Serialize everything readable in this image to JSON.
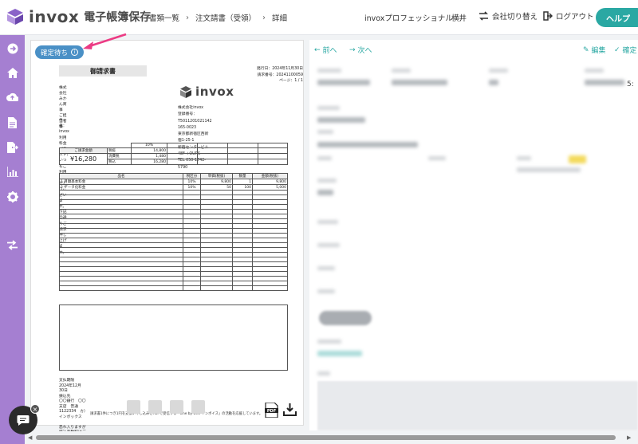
{
  "header": {
    "logo_text": "invox",
    "logo_subtitle": "電子帳簿保存",
    "breadcrumb": [
      "書類一覧",
      "注文請書（受領）",
      "詳細"
    ],
    "company": "invoxプロフェッショナル",
    "user": "横井",
    "switch_company": "会社切り替え",
    "logout": "ログアウト",
    "help": "ヘルプ"
  },
  "sidebar": {
    "items": [
      "arrow-right-circle-icon",
      "home-icon",
      "cloud-upload-icon",
      "document-icon",
      "export-icon",
      "chart-icon",
      "gear-icon",
      "switch-icon"
    ]
  },
  "document": {
    "status": "確定待ち",
    "title": "御請求書",
    "meta": [
      "発行日：2024年11月30日",
      "請求番号：20241100059",
      "ページ：1 / 1"
    ],
    "to": [
      "株式会社みかん商事",
      "ご担当者　様"
    ],
    "logo": "invox",
    "from": [
      "株式会社invox",
      "登録番号：T5011201021142",
      "165-0023",
      "東京都新宿区西新宿1-25-1",
      "新宿センタービル48F +OURS",
      "TEL 050-1742-5790"
    ],
    "subject": [
      "件名：invox利用料金（テスト）",
      "いつもご利用ありがとうございます。",
      "下記の通りご請求申し上げます。"
    ],
    "summary": {
      "total_label": "ご請求金額",
      "total": "¥16,280",
      "rate": "10%",
      "rows": [
        {
          "label": "税抜",
          "value": "14,800"
        },
        {
          "label": "消費税",
          "value": "1,480"
        },
        {
          "label": "税込",
          "value": "16,280"
        }
      ]
    },
    "line_headers": [
      "品名",
      "税区分",
      "単価(税抜)",
      "数量",
      "金額(税抜)"
    ],
    "lines": [
      {
        "name": "1 月額基本料金",
        "tax": "10%",
        "price": "9,800",
        "qty": "1",
        "amount": "9,800"
      },
      {
        "name": "2 データ化料金",
        "tax": "10%",
        "price": "50",
        "qty": "100",
        "amount": "5,000"
      }
    ],
    "footer": [
      "支払期限　　　2024年12月30日",
      "振込先　　　　〇〇銀行　〇〇支店　普通　1122334　カ）インボックス",
      "　　　　　　　恐れ入りますが振込手数料はご負担ください。"
    ],
    "note": "請求書1件につき1円を支払い申し込みをPDFで受信する「One by One インボイス」の活動を応援しています。"
  },
  "right_panel": {
    "prev": "前へ",
    "next": "次へ",
    "edit": "編集",
    "confirm": "確定",
    "edge_char": "5:"
  }
}
